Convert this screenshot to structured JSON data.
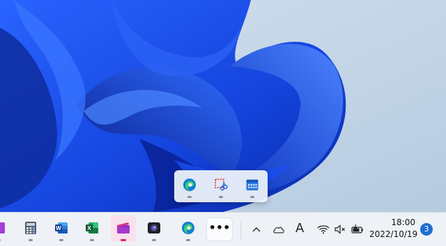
{
  "wallpaper": {
    "name": "windows-11-bloom-wallpaper",
    "colors": {
      "sky": "#c6d6e7",
      "blue_dark": "#0a2aa8",
      "blue_mid": "#1646e0",
      "blue_light": "#3d74ff"
    }
  },
  "flyout": {
    "apps": [
      {
        "name": "Microsoft Edge",
        "icon": "edge-icon"
      },
      {
        "name": "Snipping Tool",
        "icon": "snipping-tool-icon"
      },
      {
        "name": "Calendar",
        "icon": "calendar-icon"
      }
    ]
  },
  "taskbar": {
    "pinned_apps": [
      {
        "name": "OneNote",
        "icon": "onenote-icon",
        "color": "#7719aa"
      },
      {
        "name": "Calculator",
        "icon": "calculator-icon",
        "color": "#5a6b7b"
      },
      {
        "name": "Word",
        "icon": "word-icon",
        "color": "#185abd"
      },
      {
        "name": "Excel",
        "icon": "excel-icon",
        "color": "#107c41"
      },
      {
        "name": "Clipchamp",
        "icon": "clipchamp-icon",
        "color": "#b3258f",
        "active": true
      },
      {
        "name": "Camera",
        "icon": "camera-icon",
        "color": "#1b1f27"
      },
      {
        "name": "Microsoft Edge",
        "icon": "edge-icon",
        "color": "#0f7fd6"
      }
    ],
    "overflow_label": "•••",
    "tray": {
      "icons": [
        "chevron-up-icon",
        "onedrive-cloud-icon",
        "ime-icon",
        "wifi-icon",
        "speaker-muted-icon",
        "battery-charging-icon"
      ],
      "ime_char": "A"
    },
    "clock": {
      "time": "18:00",
      "date": "2022/10/19"
    },
    "notification_count": "3"
  }
}
